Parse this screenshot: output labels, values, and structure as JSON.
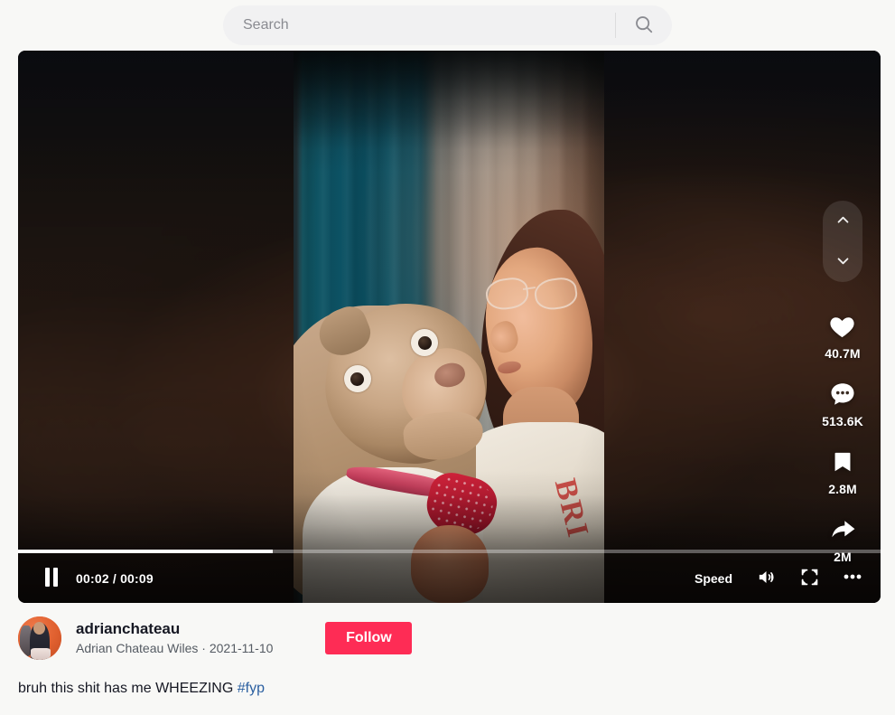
{
  "search": {
    "placeholder": "Search",
    "value": "",
    "icon": "search-icon"
  },
  "player": {
    "time_current": "00:02",
    "time_separator": "/",
    "time_total": "00:09",
    "time_display": "00:02 / 00:09",
    "progress_percent": 29.5,
    "state": "playing",
    "play_icon": "pause-icon",
    "speed_label": "Speed",
    "volume_icon": "volume-on-icon",
    "fullscreen_icon": "fullscreen-icon",
    "more_icon": "more-options-icon",
    "nav_up_icon": "chevron-up-icon",
    "nav_down_icon": "chevron-down-icon"
  },
  "actions": [
    {
      "name": "like",
      "icon": "heart-icon",
      "count": "40.7M"
    },
    {
      "name": "comment",
      "icon": "comment-icon",
      "count": "513.6K"
    },
    {
      "name": "favorite",
      "icon": "bookmark-icon",
      "count": "2.8M"
    },
    {
      "name": "share",
      "icon": "share-arrow-icon",
      "count": "2M"
    }
  ],
  "author": {
    "unique_id": "adrianchateau",
    "nickname": "Adrian Chateau Wiles",
    "separator": "·",
    "date": "2021-11-10",
    "meta_line": "Adrian Chateau Wiles · 2021-11-10",
    "follow_label": "Follow",
    "avatar_alt": "adrianchateau avatar"
  },
  "post": {
    "caption_text": "bruh this shit has me WHEEZING ",
    "hashtag": "#fyp"
  },
  "video": {
    "shirt_text": "BRI"
  },
  "colors": {
    "accent_red": "#fe2c55",
    "link_blue": "#2b5fa0",
    "page_bg": "#f8f8f6",
    "search_bg": "#f1f1f2",
    "text_primary": "#161823",
    "text_secondary": "#555b63"
  }
}
